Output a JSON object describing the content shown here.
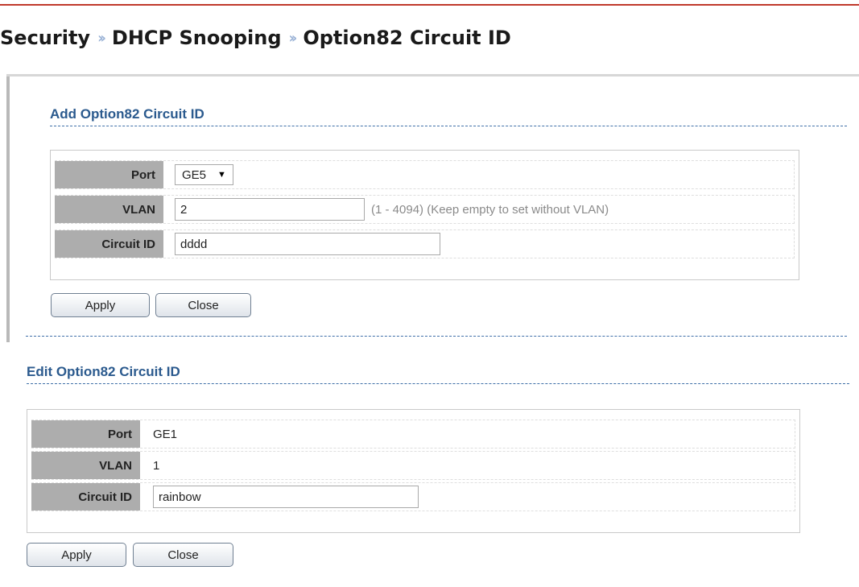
{
  "breadcrumb": {
    "items": [
      "Security",
      "DHCP Snooping",
      "Option82 Circuit ID"
    ],
    "separator": "››"
  },
  "add_section": {
    "title": "Add Option82 Circuit ID",
    "port_label": "Port",
    "port_value": "GE5",
    "vlan_label": "VLAN",
    "vlan_value": "2",
    "vlan_hint": "(1 - 4094) (Keep empty to set without VLAN)",
    "circuit_label": "Circuit ID",
    "circuit_value": "dddd",
    "apply_label": "Apply",
    "close_label": "Close"
  },
  "edit_section": {
    "title": "Edit Option82 Circuit ID",
    "port_label": "Port",
    "port_value": "GE1",
    "vlan_label": "VLAN",
    "vlan_value": "1",
    "circuit_label": "Circuit ID",
    "circuit_value": "rainbow",
    "apply_label": "Apply",
    "close_label": "Close"
  },
  "colors": {
    "accent_red": "#c0392b",
    "section_title_blue": "#2b5a8e",
    "label_bg_gray": "#adadad"
  }
}
